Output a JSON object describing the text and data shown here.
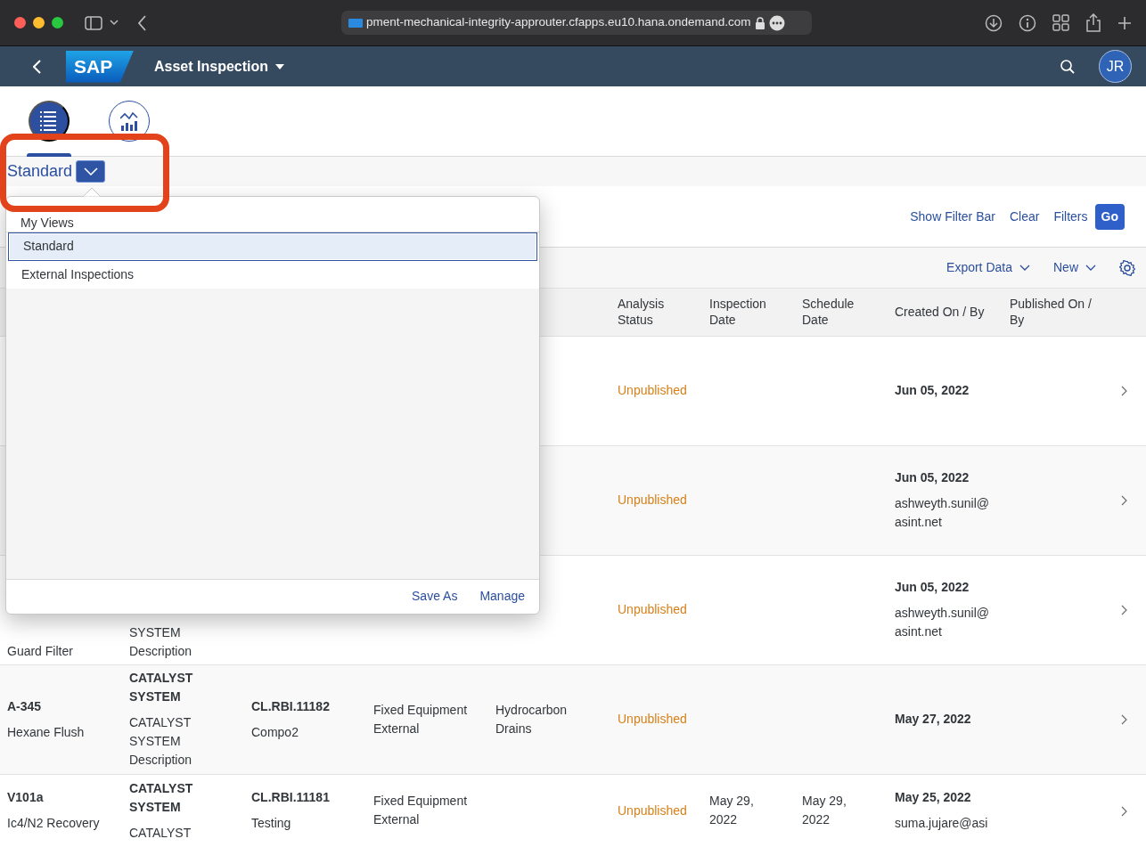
{
  "browser": {
    "url": "pment-mechanical-integrity-approuter.cfapps.eu10.hana.ondemand.com"
  },
  "shell": {
    "logo": "SAP",
    "title": "Asset Inspection",
    "avatar": "JR"
  },
  "view_tabs": [
    {
      "kind": "list",
      "selected": true
    },
    {
      "kind": "chart",
      "selected": false
    }
  ],
  "variant": {
    "label": "Standard",
    "expanded": true
  },
  "filter_bar": {
    "links": [
      "Show Filter Bar",
      "Clear",
      "Filters"
    ],
    "go": "Go"
  },
  "toolbar": {
    "menus": [
      "Export Data",
      "New"
    ]
  },
  "table": {
    "columns": [
      "",
      "",
      "",
      "",
      "",
      "Analysis Status",
      "Inspection Date",
      "Schedule Date",
      "Created On / By",
      "Published On / By"
    ],
    "rows": [
      {
        "cells": [
          null,
          null,
          null,
          null,
          null,
          {
            "status": "Unpublished"
          },
          null,
          null,
          {
            "title": [
              "Jun 05, 2022"
            ]
          },
          null
        ]
      },
      {
        "cells": [
          null,
          null,
          null,
          null,
          null,
          {
            "status": "Unpublished"
          },
          null,
          null,
          {
            "title": [
              "Jun 05, 2022"
            ],
            "text": [
              "ashweyth.sunil@",
              "asint.net"
            ]
          },
          null
        ]
      },
      {
        "cells": [
          {
            "text": [
              "Guard Filter"
            ]
          },
          {
            "text": [
              "SYSTEM",
              "Description"
            ]
          },
          null,
          null,
          null,
          {
            "status": "Unpublished"
          },
          null,
          null,
          {
            "title": [
              "Jun 05, 2022"
            ],
            "text": [
              "ashweyth.sunil@",
              "asint.net"
            ]
          },
          null
        ]
      },
      {
        "cells": [
          {
            "title": [
              "A-345"
            ],
            "text": [
              "Hexane Flush"
            ]
          },
          {
            "title": [
              "CATALYST",
              "SYSTEM"
            ],
            "text": [
              "CATALYST",
              "SYSTEM",
              "Description"
            ]
          },
          {
            "title": [
              "CL.RBI.11182"
            ],
            "text": [
              "Compo2"
            ]
          },
          {
            "text": [
              "Fixed Equipment",
              "External"
            ]
          },
          {
            "text": [
              "Hydrocarbon",
              "Drains"
            ]
          },
          {
            "status": "Unpublished"
          },
          null,
          null,
          {
            "title": [
              "May 27, 2022"
            ]
          },
          null
        ]
      },
      {
        "cells": [
          {
            "title": [
              "V101a"
            ],
            "text": [
              "Ic4/N2 Recovery"
            ]
          },
          {
            "title": [
              "CATALYST",
              "SYSTEM"
            ],
            "text": [
              "CATALYST"
            ]
          },
          {
            "title": [
              "CL.RBI.11181"
            ],
            "text": [
              "Testing"
            ]
          },
          {
            "text": [
              "Fixed Equipment",
              "External"
            ]
          },
          null,
          {
            "status": "Unpublished"
          },
          {
            "text": [
              "May 29,",
              "2022"
            ]
          },
          {
            "text": [
              "May 29,",
              "2022"
            ]
          },
          {
            "title": [
              "May 25, 2022"
            ],
            "text": [
              "suma.jujare@asi"
            ]
          },
          null
        ]
      }
    ]
  },
  "views_popover": {
    "heading": "My Views",
    "items": [
      {
        "label": "Standard",
        "selected": true
      },
      {
        "label": "External Inspections",
        "selected": false
      }
    ],
    "actions": [
      "Save As",
      "Manage"
    ]
  }
}
